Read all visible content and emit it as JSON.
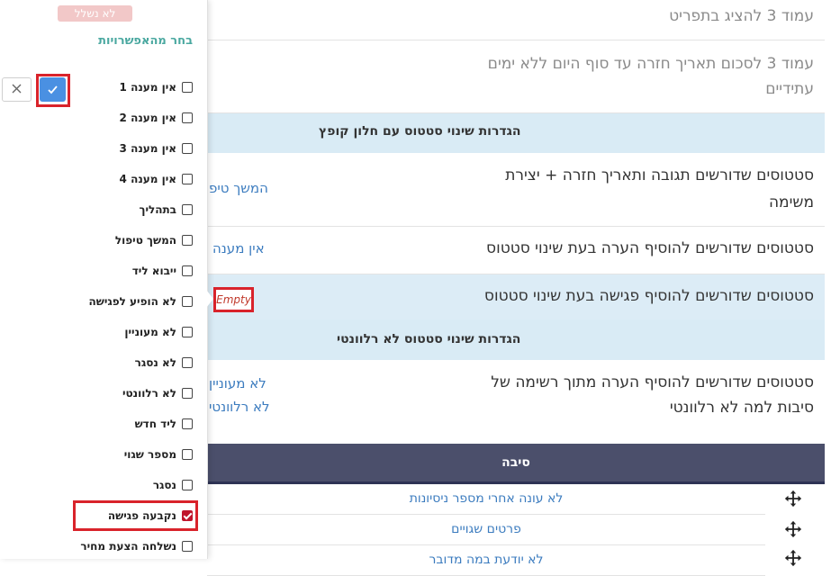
{
  "settings": {
    "row1_label": "עמוד 3 להציג בתפריט",
    "row2_label_line1": "עמוד 3 לסכום תאריך חזרה עד סוף היום ללא ימים",
    "row2_label_line2": "עתידיים",
    "section1_title": "הגדרות שינוי סטטוס עם חלון קופץ",
    "row3_label_line1": "סטטוסים שדורשים תגובה ותאריך חזרה + יצירת",
    "row3_label_line2": "משימה",
    "row3_value": "המשך טיפ",
    "row4_label": "סטטוסים שדורשים להוסיף הערה בעת שינוי סטטוס",
    "row4_value": "אין מענה",
    "row5_label": "סטטוסים שדורשים להוסיף פגישה בעת שינוי סטטוס",
    "row5_value": "Empty",
    "section2_title": "הגדרות שינוי סטטוס לא רלוונטי",
    "row6_label_line1": "סטטוסים שדורשים להוסיף הערה מתוך רשימה של",
    "row6_label_line2": "סיבות למה לא רלוונטי",
    "row6_value1": "לא מעוניין",
    "row6_value2": "לא רלוונטי"
  },
  "reasons": {
    "header": "סיבה",
    "rows": [
      "לא עונה אחרי מספר ניסיונות",
      "פרטים שגויים",
      "לא יודעת במה מדובר"
    ]
  },
  "popover": {
    "faded_tag": "לא נשלל",
    "title": "בחר מהאפשרויות",
    "options": [
      {
        "label": "אין מענה 1",
        "checked": false
      },
      {
        "label": "אין מענה 2",
        "checked": false
      },
      {
        "label": "אין מענה 3",
        "checked": false
      },
      {
        "label": "אין מענה 4",
        "checked": false
      },
      {
        "label": "בתהליך",
        "checked": false
      },
      {
        "label": "המשך טיפול",
        "checked": false
      },
      {
        "label": "ייבוא ליד",
        "checked": false
      },
      {
        "label": "לא הופיע לפגישה",
        "checked": false
      },
      {
        "label": "לא מעוניין",
        "checked": false
      },
      {
        "label": "לא נסגר",
        "checked": false
      },
      {
        "label": "לא רלוונטי",
        "checked": false
      },
      {
        "label": "ליד חדש",
        "checked": false
      },
      {
        "label": "מספר שגוי",
        "checked": false
      },
      {
        "label": "נסגר",
        "checked": false
      },
      {
        "label": "נקבעה פגישה",
        "checked": true
      },
      {
        "label": "נשלחה הצעת מחיר",
        "checked": false
      }
    ]
  },
  "colors": {
    "accent_blue": "#4a90e2",
    "highlight_red": "#d9232b",
    "section_bg": "#d9ebf5",
    "header_bg": "#4b4f6b"
  },
  "icons": {
    "ok": "check-icon",
    "cancel": "close-icon",
    "drag": "move-icon"
  }
}
